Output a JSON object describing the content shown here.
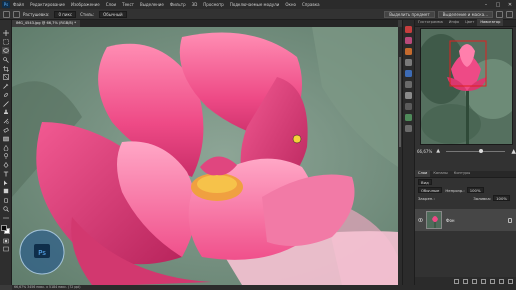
{
  "app": {
    "logo": "Ps",
    "menu": [
      "Файл",
      "Редактирование",
      "Изображение",
      "Слои",
      "Текст",
      "Выделение",
      "Фильтр",
      "3D",
      "Просмотр",
      "Подключаемые модули",
      "Окно",
      "Справка"
    ]
  },
  "options": {
    "feather_label": "Растушевка:",
    "feather_value": "0 пикс",
    "style_label": "Стиль:",
    "style_value": "Обычный",
    "select_subject": "Выделить предмет",
    "select_mask": "Выделение и маска..."
  },
  "document": {
    "tab_title": "IMG_4543.jpg @ 66,7% (RGB/8) *",
    "status": "66,67%   3456 пикс. x 5184 пикс. (72 ppi)"
  },
  "navigator": {
    "tabs": [
      "Гистограмма",
      "Инфо",
      "Цвет",
      "Навигатор"
    ],
    "active_tab": "Навигатор",
    "zoom": "66,67%"
  },
  "layers": {
    "tabs": [
      "Слои",
      "Каналы",
      "Контуры"
    ],
    "active_tab": "Слои",
    "kind_label": "Вид",
    "blend_mode": "Обычные",
    "opacity_label": "Непрозр.:",
    "opacity_value": "100%",
    "lock_label": "Закреп.:",
    "fill_label": "Заливка:",
    "fill_value": "100%",
    "layer_name": "Фон"
  },
  "colors": {
    "accent": "#e8387a",
    "petal": "#ef4a86",
    "leaf": "#6e8a78",
    "foreground": "#0a0a0a",
    "background": "#ffffff"
  }
}
